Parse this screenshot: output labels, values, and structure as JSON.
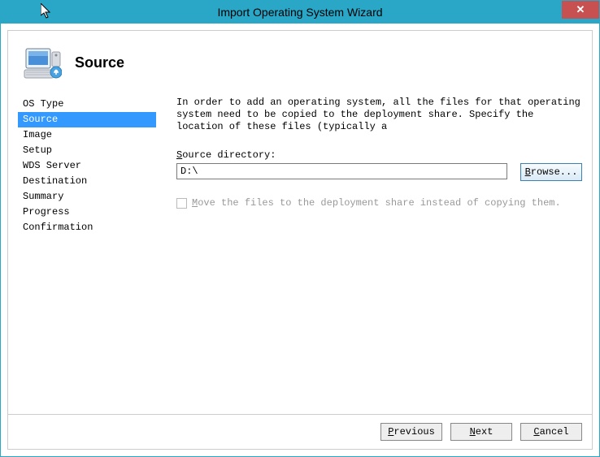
{
  "title": "Import Operating System Wizard",
  "page_heading": "Source",
  "sidebar": {
    "items": [
      {
        "label": "OS Type"
      },
      {
        "label": "Source",
        "selected": true
      },
      {
        "label": "Image"
      },
      {
        "label": "Setup"
      },
      {
        "label": "WDS Server"
      },
      {
        "label": "Destination"
      },
      {
        "label": "Summary"
      },
      {
        "label": "Progress"
      },
      {
        "label": "Confirmation"
      }
    ]
  },
  "main": {
    "instruction": "In order to add an operating system, all the files for that operating system need to be copied to the deployment share.  Specify the location of these files (typically a",
    "source_dir_label_pre": "S",
    "source_dir_label_post": "ource directory:",
    "source_dir_value": "D:\\",
    "browse_pre": "B",
    "browse_post": "rowse...",
    "checkbox_pre": "M",
    "checkbox_post": "ove the files to the deployment share instead of copying them."
  },
  "footer": {
    "previous_pre": "P",
    "previous_post": "revious",
    "next_pre": "N",
    "next_post": "ext",
    "cancel_pre": "C",
    "cancel_post": "ancel"
  }
}
